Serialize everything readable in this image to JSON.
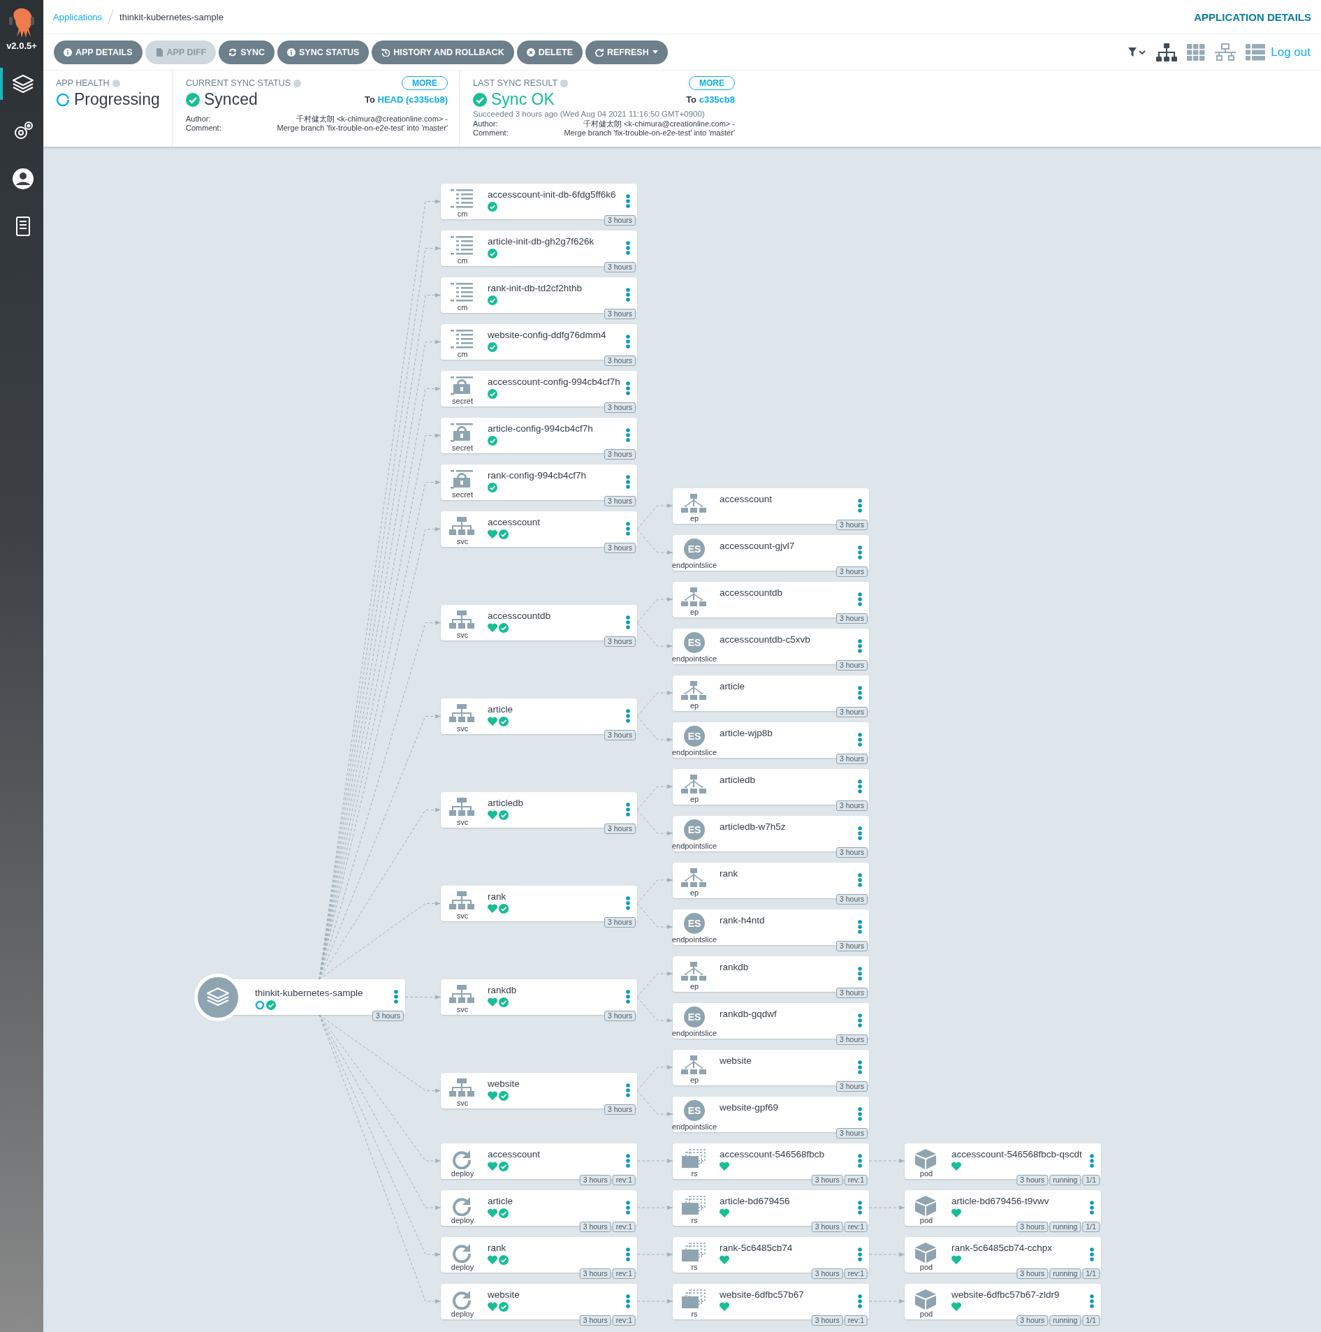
{
  "sidebar": {
    "version": "v2.0.5+",
    "items": [
      {
        "kind": "applications",
        "selected": true
      },
      {
        "kind": "settings",
        "selected": false
      },
      {
        "kind": "user",
        "selected": false
      },
      {
        "kind": "docs",
        "selected": false
      }
    ]
  },
  "breadcrumb": [
    {
      "label": "Applications",
      "link": true
    },
    {
      "label": "thinkit-kubernetes-sample",
      "link": false
    }
  ],
  "page_title": "APPLICATION DETAILS",
  "toolbar": {
    "buttons": [
      {
        "kind": "details",
        "label": "APP DETAILS",
        "disabled": false,
        "dropdown": false
      },
      {
        "kind": "diff",
        "label": "APP DIFF",
        "disabled": true,
        "dropdown": false
      },
      {
        "kind": "sync",
        "label": "SYNC",
        "disabled": false,
        "dropdown": false
      },
      {
        "kind": "sync-status",
        "label": "SYNC STATUS",
        "disabled": false,
        "dropdown": false
      },
      {
        "kind": "history",
        "label": "HISTORY AND ROLLBACK",
        "disabled": false,
        "dropdown": false
      },
      {
        "kind": "delete",
        "label": "DELETE",
        "disabled": false,
        "dropdown": false
      },
      {
        "kind": "refresh",
        "label": "REFRESH",
        "disabled": false,
        "dropdown": true
      }
    ],
    "views": [
      {
        "kind": "tree",
        "selected": true
      },
      {
        "kind": "pods",
        "selected": false
      },
      {
        "kind": "network",
        "selected": false
      },
      {
        "kind": "list",
        "selected": false
      }
    ],
    "logout": "Log out"
  },
  "summary": {
    "app_health": {
      "label": "APP HEALTH",
      "status": "Progressing",
      "progressing": true
    },
    "sync_status": {
      "label": "CURRENT SYNC STATUS",
      "more": "MORE",
      "status": "Synced",
      "synced": true,
      "to": "To",
      "revision": "HEAD (c335cb8)",
      "author_label": "Author:",
      "author": "千村健太朗 <k-chimura@creationline.com> -",
      "comment_label": "Comment:",
      "comment": "Merge branch 'fix-trouble-on-e2e-test' into 'master'"
    },
    "last_sync": {
      "label": "LAST SYNC RESULT",
      "more": "MORE",
      "status": "Sync OK",
      "synced": true,
      "to": "To",
      "revision": "c335cb8",
      "succeeded": "Succeeded 3 hours ago (Wed Aug 04 2021 11:16:50 GMT+0900)",
      "author_label": "Author:",
      "author": "千村健太朗 <k-chimura@creationline.com> -",
      "comment_label": "Comment:",
      "comment": "Merge branch 'fix-trouble-on-e2e-test' into 'master'"
    }
  },
  "tree": {
    "name": "thinkit-kubernetes-sample",
    "kind": "application",
    "progressing": true,
    "synced": true,
    "badges": [
      "3 hours"
    ],
    "children": [
      {
        "name": "accesscount-init-db-6fdg5ff6k6",
        "kind": "configmap",
        "type": "cm",
        "synced": true,
        "badges": [
          "3 hours"
        ]
      },
      {
        "name": "article-init-db-gh2g7f626k",
        "kind": "configmap",
        "type": "cm",
        "synced": true,
        "badges": [
          "3 hours"
        ]
      },
      {
        "name": "rank-init-db-td2cf2hthb",
        "kind": "configmap",
        "type": "cm",
        "synced": true,
        "badges": [
          "3 hours"
        ]
      },
      {
        "name": "website-config-ddfg76dmm4",
        "kind": "configmap",
        "type": "cm",
        "synced": true,
        "badges": [
          "3 hours"
        ]
      },
      {
        "name": "accesscount-config-994cb4cf7h",
        "kind": "secret",
        "type": "secret",
        "synced": true,
        "badges": [
          "3 hours"
        ]
      },
      {
        "name": "article-config-994cb4cf7h",
        "kind": "secret",
        "type": "secret",
        "synced": true,
        "badges": [
          "3 hours"
        ]
      },
      {
        "name": "rank-config-994cb4cf7h",
        "kind": "secret",
        "type": "secret",
        "synced": true,
        "badges": [
          "3 hours"
        ]
      },
      {
        "name": "accesscount",
        "kind": "service",
        "type": "svc",
        "healthy": true,
        "synced": true,
        "badges": [
          "3 hours"
        ],
        "children": [
          {
            "name": "accesscount",
            "kind": "endpoints",
            "type": "ep",
            "badges": [
              "3 hours"
            ]
          },
          {
            "name": "accesscount-gjvl7",
            "kind": "endpointslice",
            "type": "endpointslice",
            "icon_text": "ES",
            "badges": [
              "3 hours"
            ]
          }
        ]
      },
      {
        "name": "accesscountdb",
        "kind": "service",
        "type": "svc",
        "healthy": true,
        "synced": true,
        "badges": [
          "3 hours"
        ],
        "children": [
          {
            "name": "accesscountdb",
            "kind": "endpoints",
            "type": "ep",
            "badges": [
              "3 hours"
            ]
          },
          {
            "name": "accesscountdb-c5xvb",
            "kind": "endpointslice",
            "type": "endpointslice",
            "icon_text": "ES",
            "badges": [
              "3 hours"
            ]
          }
        ]
      },
      {
        "name": "article",
        "kind": "service",
        "type": "svc",
        "healthy": true,
        "synced": true,
        "badges": [
          "3 hours"
        ],
        "children": [
          {
            "name": "article",
            "kind": "endpoints",
            "type": "ep",
            "badges": [
              "3 hours"
            ]
          },
          {
            "name": "article-wjp8b",
            "kind": "endpointslice",
            "type": "endpointslice",
            "icon_text": "ES",
            "badges": [
              "3 hours"
            ]
          }
        ]
      },
      {
        "name": "articledb",
        "kind": "service",
        "type": "svc",
        "healthy": true,
        "synced": true,
        "badges": [
          "3 hours"
        ],
        "children": [
          {
            "name": "articledb",
            "kind": "endpoints",
            "type": "ep",
            "badges": [
              "3 hours"
            ]
          },
          {
            "name": "articledb-w7h5z",
            "kind": "endpointslice",
            "type": "endpointslice",
            "icon_text": "ES",
            "badges": [
              "3 hours"
            ]
          }
        ]
      },
      {
        "name": "rank",
        "kind": "service",
        "type": "svc",
        "healthy": true,
        "synced": true,
        "badges": [
          "3 hours"
        ],
        "children": [
          {
            "name": "rank",
            "kind": "endpoints",
            "type": "ep",
            "badges": [
              "3 hours"
            ]
          },
          {
            "name": "rank-h4ntd",
            "kind": "endpointslice",
            "type": "endpointslice",
            "icon_text": "ES",
            "badges": [
              "3 hours"
            ]
          }
        ]
      },
      {
        "name": "rankdb",
        "kind": "service",
        "type": "svc",
        "healthy": true,
        "synced": true,
        "badges": [
          "3 hours"
        ],
        "children": [
          {
            "name": "rankdb",
            "kind": "endpoints",
            "type": "ep",
            "badges": [
              "3 hours"
            ]
          },
          {
            "name": "rankdb-gqdwf",
            "kind": "endpointslice",
            "type": "endpointslice",
            "icon_text": "ES",
            "badges": [
              "3 hours"
            ]
          }
        ]
      },
      {
        "name": "website",
        "kind": "service",
        "type": "svc",
        "healthy": true,
        "synced": true,
        "badges": [
          "3 hours"
        ],
        "children": [
          {
            "name": "website",
            "kind": "endpoints",
            "type": "ep",
            "badges": [
              "3 hours"
            ]
          },
          {
            "name": "website-gpf69",
            "kind": "endpointslice",
            "type": "endpointslice",
            "icon_text": "ES",
            "badges": [
              "3 hours"
            ]
          }
        ]
      },
      {
        "name": "accesscount",
        "kind": "deployment",
        "type": "deploy",
        "healthy": true,
        "synced": true,
        "badges": [
          "3 hours",
          "rev:1"
        ],
        "children": [
          {
            "name": "accesscount-546568fbcb",
            "kind": "replicaset",
            "type": "rs",
            "healthy": true,
            "badges": [
              "3 hours",
              "rev:1"
            ],
            "children": [
              {
                "name": "accesscount-546568fbcb-qscdt",
                "kind": "pod",
                "type": "pod",
                "healthy": true,
                "badges": [
                  "3 hours",
                  "running",
                  "1/1"
                ]
              }
            ]
          }
        ]
      },
      {
        "name": "article",
        "kind": "deployment",
        "type": "deploy",
        "healthy": true,
        "synced": true,
        "badges": [
          "3 hours",
          "rev:1"
        ],
        "children": [
          {
            "name": "article-bd679456",
            "kind": "replicaset",
            "type": "rs",
            "healthy": true,
            "badges": [
              "3 hours",
              "rev:1"
            ],
            "children": [
              {
                "name": "article-bd679456-t9vwv",
                "kind": "pod",
                "type": "pod",
                "healthy": true,
                "badges": [
                  "3 hours",
                  "running",
                  "1/1"
                ]
              }
            ]
          }
        ]
      },
      {
        "name": "rank",
        "kind": "deployment",
        "type": "deploy",
        "healthy": true,
        "synced": true,
        "badges": [
          "3 hours",
          "rev:1"
        ],
        "children": [
          {
            "name": "rank-5c6485cb74",
            "kind": "replicaset",
            "type": "rs",
            "healthy": true,
            "badges": [
              "3 hours",
              "rev:1"
            ],
            "children": [
              {
                "name": "rank-5c6485cb74-cchpx",
                "kind": "pod",
                "type": "pod",
                "healthy": true,
                "badges": [
                  "3 hours",
                  "running",
                  "1/1"
                ]
              }
            ]
          }
        ]
      },
      {
        "name": "website",
        "kind": "deployment",
        "type": "deploy",
        "healthy": true,
        "synced": true,
        "badges": [
          "3 hours",
          "rev:1"
        ],
        "children": [
          {
            "name": "website-6dfbc57b67",
            "kind": "replicaset",
            "type": "rs",
            "healthy": true,
            "badges": [
              "3 hours",
              "rev:1"
            ],
            "children": [
              {
                "name": "website-6dfbc57b67-zldr9",
                "kind": "pod",
                "type": "pod",
                "healthy": true,
                "badges": [
                  "3 hours",
                  "running",
                  "1/1"
                ]
              }
            ]
          }
        ]
      }
    ]
  }
}
